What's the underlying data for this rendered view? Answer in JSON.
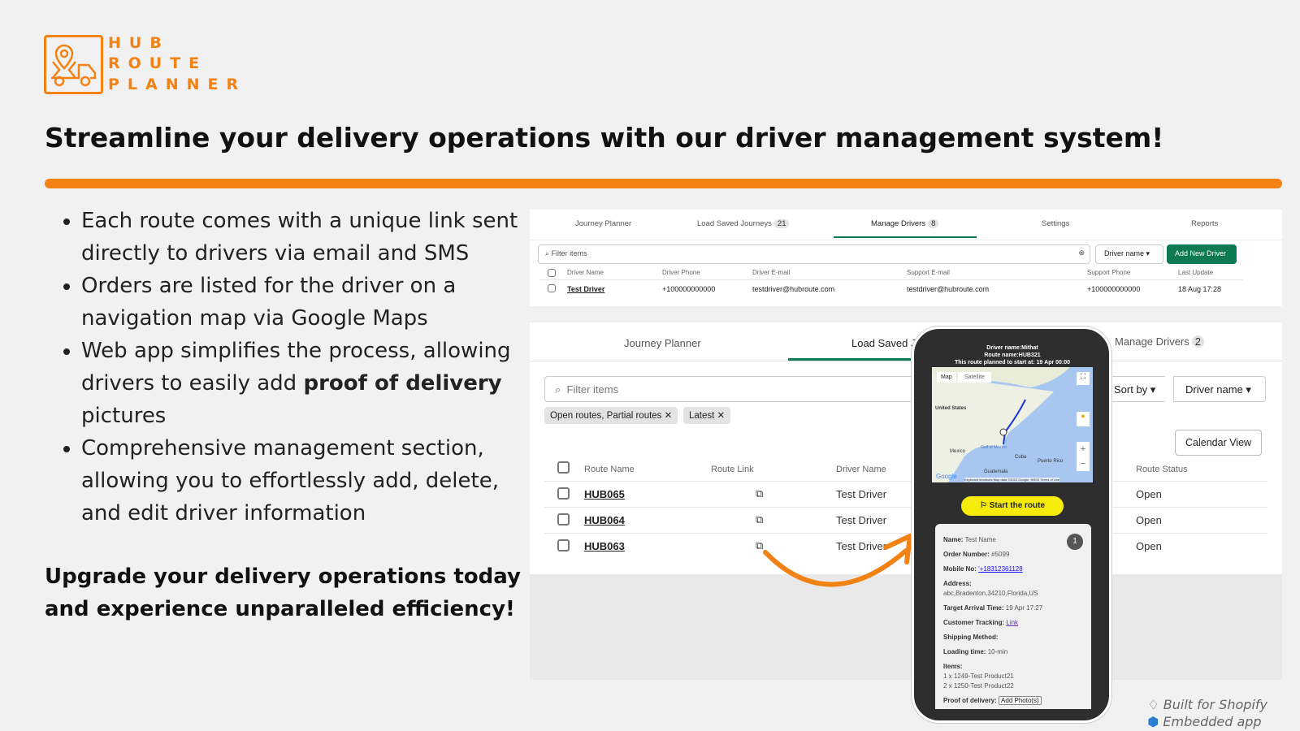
{
  "brand": {
    "line1": "HUB",
    "line2": "ROUTE",
    "line3": "PLANNER",
    "accent": "#f28213"
  },
  "headline": "Streamline your delivery operations with our driver management system!",
  "bullets": [
    "Each route comes with a unique link sent directly to drivers via email and SMS",
    "Orders are listed for the driver on a navigation map via Google Maps",
    {
      "before": "Web app simplifies the process, allowing drivers to easily add ",
      "bold": "proof of delivery",
      "after": " pictures"
    },
    "Comprehensive management section, allowing you to effortlessly add, delete, and edit driver information"
  ],
  "closing": "Upgrade your delivery operations today and experience unparalleled efficiency!",
  "top_app": {
    "tabs": [
      {
        "label": "Journey Planner"
      },
      {
        "label": "Load Saved Journeys",
        "badge": "21"
      },
      {
        "label": "Manage Drivers",
        "badge": "8",
        "active": true
      },
      {
        "label": "Settings"
      },
      {
        "label": "Reports"
      }
    ],
    "filter_placeholder": "Filter items",
    "sort_select": "Driver name",
    "add_button": "Add New Driver",
    "columns": [
      "Driver Name",
      "Driver Phone",
      "Driver E-mail",
      "Support E-mail",
      "Support Phone",
      "Last Update"
    ],
    "rows": [
      [
        "Test Driver",
        "+100000000000",
        "testdriver@hubroute.com",
        "testdriver@hubroute.com",
        "+100000000000",
        "18 Aug 17:28"
      ]
    ]
  },
  "lower_app": {
    "tabs": [
      {
        "label": "Journey Planner"
      },
      {
        "label": "Load Saved J",
        "active": true
      },
      {
        "label": "Manage Drivers",
        "badge": "2"
      }
    ],
    "filter_placeholder": "Filter items",
    "sort_by": "Sort by",
    "sort_select": "Driver name",
    "chips": [
      "Open routes, Partial routes",
      "Latest"
    ],
    "calendar_button": "Calendar View",
    "columns": [
      "Route Name",
      "Route Link",
      "Driver Name",
      "Route Status"
    ],
    "rows": [
      [
        "HUB065",
        "Test Driver",
        "Open"
      ],
      [
        "HUB064",
        "Test Driver",
        "Open"
      ],
      [
        "HUB063",
        "Test Driver",
        "Open"
      ]
    ]
  },
  "phone": {
    "header": [
      "Driver name:Mithat",
      "Route name:HUB321",
      "This route planned to start at: 19 Apr 00:00"
    ],
    "map_tabs": [
      "Map",
      "Satellite"
    ],
    "map_labels": [
      "United States",
      "Mexico",
      "Gulf of Mexico",
      "Cuba",
      "Puerto Rico",
      "Guatemala"
    ],
    "map_footer": "Keyboard shortcuts  Map data ©2023 Google, INEGI  Terms of Use",
    "google": "Google",
    "start_button": "Start the route",
    "stop_number": "1",
    "fields": [
      {
        "label": "Name:",
        "value": "Test Name"
      },
      {
        "label": "Order Number:",
        "value": "#5099"
      },
      {
        "label": "Mobile No:",
        "value": "'+18312361128",
        "link": true
      },
      {
        "label": "Address:",
        "value": "abc,Bradenton,34210,Florida,US",
        "block": true
      },
      {
        "label": "Target Arrival Time:",
        "value": "19 Apr 17:27"
      },
      {
        "label": "Customer Tracking:",
        "value": "Link",
        "link": true
      },
      {
        "label": "Shipping Method:",
        "value": ""
      },
      {
        "label": "Loading time:",
        "value": "10-min"
      },
      {
        "label": "Items:",
        "value": "1 x 1249-Test Product21",
        "value2": "2 x 1250-Test Product22",
        "block": true
      },
      {
        "label": "Proof of delivery:",
        "value": "Add Photo(s)",
        "button": true
      }
    ]
  },
  "badges": {
    "shopify": "Built for Shopify",
    "embedded": "Embedded app"
  }
}
